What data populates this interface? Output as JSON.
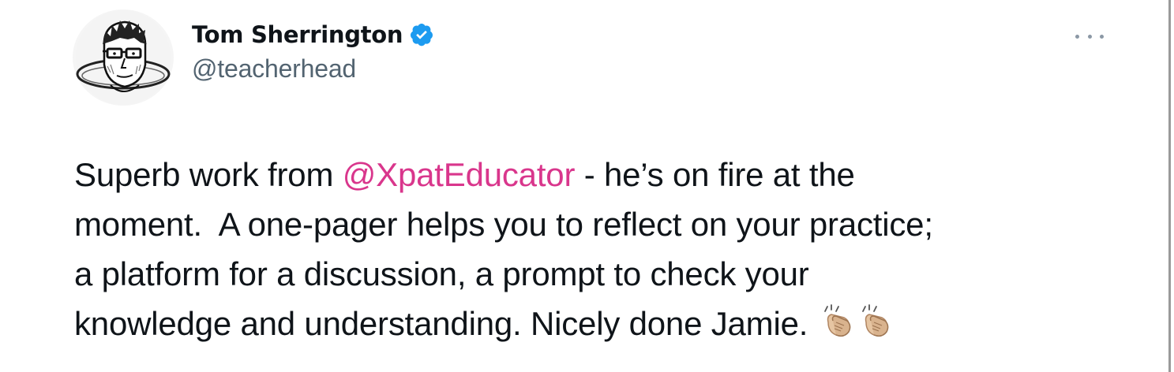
{
  "tweet": {
    "author": {
      "display_name": "Tom Sherrington",
      "handle": "@teacherhead",
      "verified": true,
      "avatar_icon": "cartoon-portrait-avatar",
      "verified_icon": "verified-badge-icon",
      "verified_color": "#1d9bf0"
    },
    "more_icon": "more-options-icon",
    "text": {
      "line1_before": "Superb work from ",
      "mention": "@XpatEducator",
      "line1_after": " - he’s on fire at the",
      "line2": "moment.  A one-pager helps you to reflect on your practice;",
      "line3": "a platform for a discussion, a prompt to check your",
      "line4": "knowledge and understanding. Nicely done Jamie. "
    },
    "emoji": [
      "clapping-hands-icon",
      "clapping-hands-icon"
    ],
    "colors": {
      "mention": "#d9368c",
      "text": "#0f1419",
      "secondary": "#536471"
    }
  }
}
